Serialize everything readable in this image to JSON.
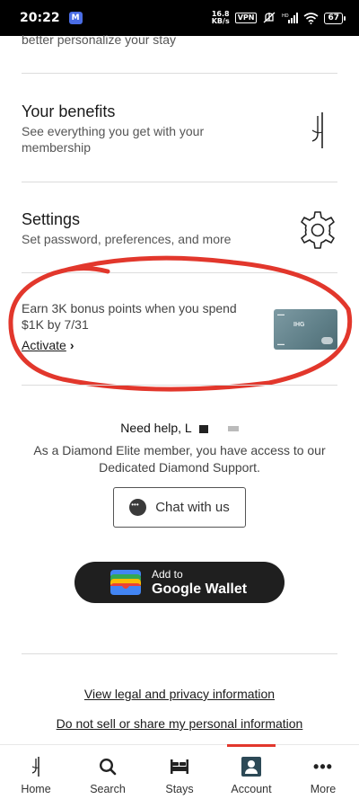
{
  "status_bar": {
    "time": "20:22",
    "app_badge": "M",
    "net_speed_value": "16.8",
    "net_speed_unit": "KB/s",
    "vpn": "VPN",
    "battery": "67"
  },
  "partial_text": "better personalize your stay",
  "benefits": {
    "title": "Your benefits",
    "subtitle": "See everything you get with your membership"
  },
  "settings": {
    "title": "Settings",
    "subtitle": "Set password, preferences, and more"
  },
  "promo": {
    "text": "Earn 3K bonus points when you spend $1K by 7/31",
    "link": "Activate",
    "link_chevron": "›",
    "card_logo": "IHG",
    "annotation_color": "#e2372c"
  },
  "help": {
    "title": "Need help, L",
    "text": "As a Diamond Elite member, you have access to our Dedicated Diamond Support.",
    "chat_button": "Chat with us"
  },
  "wallet": {
    "add_to": "Add to",
    "name": "Google Wallet"
  },
  "links": {
    "legal": "View legal and privacy information",
    "do_not_sell": "Do not sell or share my personal information"
  },
  "nav": {
    "items": [
      {
        "label": "Home",
        "icon": "ihg-logo-icon"
      },
      {
        "label": "Search",
        "icon": "search-icon"
      },
      {
        "label": "Stays",
        "icon": "bed-icon"
      },
      {
        "label": "Account",
        "icon": "account-icon",
        "active": true
      },
      {
        "label": "More",
        "icon": "more-icon"
      }
    ],
    "active_color": "#e2372c"
  }
}
